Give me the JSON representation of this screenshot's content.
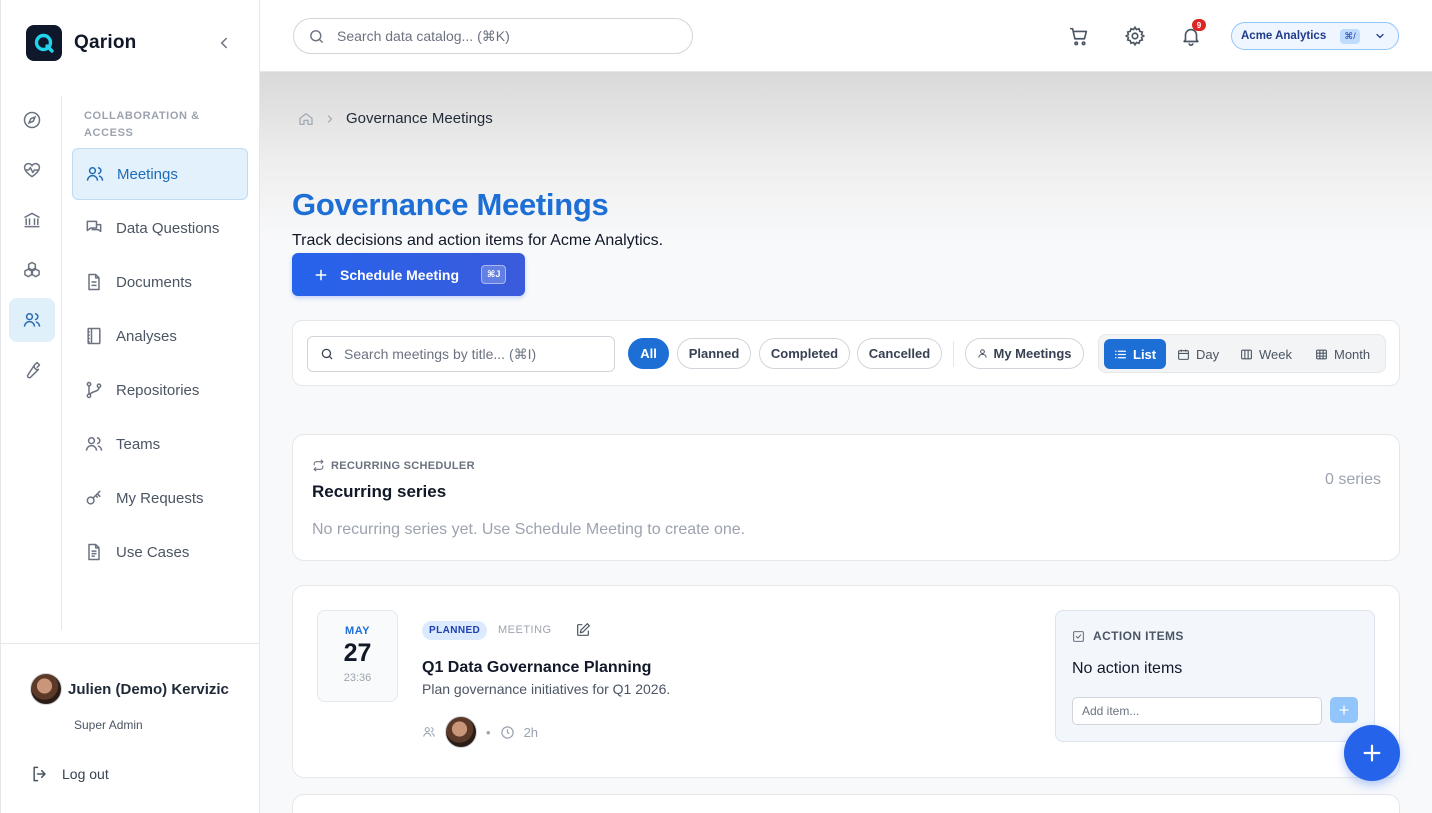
{
  "app": {
    "name": "Qarion"
  },
  "header": {
    "search_placeholder": "Search data catalog... (⌘K)",
    "notification_count": "9",
    "org_name": "Acme Analytics",
    "org_shortcut": "⌘/"
  },
  "rail": {
    "items": [
      {
        "icon": "compass-icon"
      },
      {
        "icon": "heart-pulse-icon"
      },
      {
        "icon": "bank-icon"
      },
      {
        "icon": "cubes-icon"
      },
      {
        "icon": "users-icon",
        "active": true
      },
      {
        "icon": "wrench-icon"
      }
    ]
  },
  "sidebar": {
    "section_label": "COLLABORATION & ACCESS",
    "items": [
      {
        "label": "Meetings",
        "icon": "users-icon",
        "active": true
      },
      {
        "label": "Data Questions",
        "icon": "chat-icon"
      },
      {
        "label": "Documents",
        "icon": "document-icon"
      },
      {
        "label": "Analyses",
        "icon": "notebook-icon"
      },
      {
        "label": "Repositories",
        "icon": "git-branch-icon"
      },
      {
        "label": "Teams",
        "icon": "users-icon"
      },
      {
        "label": "My Requests",
        "icon": "key-icon"
      },
      {
        "label": "Use Cases",
        "icon": "file-text-icon"
      }
    ],
    "user": {
      "name": "Julien (Demo) Kervizic",
      "role": "Super Admin"
    },
    "logout_label": "Log out"
  },
  "breadcrumb": {
    "current": "Governance Meetings"
  },
  "page": {
    "title": "Governance Meetings",
    "subtitle": "Track decisions and action items for Acme Analytics.",
    "schedule_label": "Schedule Meeting",
    "schedule_shortcut": "⌘J"
  },
  "filters": {
    "search_placeholder": "Search meetings by title... (⌘I)",
    "status_pills": [
      "All",
      "Planned",
      "Completed",
      "Cancelled"
    ],
    "active_status": "All",
    "my_meetings_label": "My Meetings",
    "views": [
      "List",
      "Day",
      "Week",
      "Month"
    ],
    "active_view": "List"
  },
  "recurring": {
    "eyebrow": "RECURRING SCHEDULER",
    "title": "Recurring series",
    "count": "0 series",
    "empty": "No recurring series yet. Use Schedule Meeting to create one."
  },
  "meeting": {
    "month": "MAY",
    "day": "27",
    "time": "23:36",
    "status": "PLANNED",
    "type": "MEETING",
    "title": "Q1 Data Governance Planning",
    "description": "Plan governance initiatives for Q1 2026.",
    "duration": "2h",
    "actions": {
      "heading": "ACTION ITEMS",
      "empty": "No action items",
      "input_placeholder": "Add item..."
    }
  },
  "colors": {
    "accent": "#1d6fd6",
    "primary_button": "#2563eb",
    "status_badge_bg": "#dbeafe",
    "notification": "#dc2626"
  }
}
